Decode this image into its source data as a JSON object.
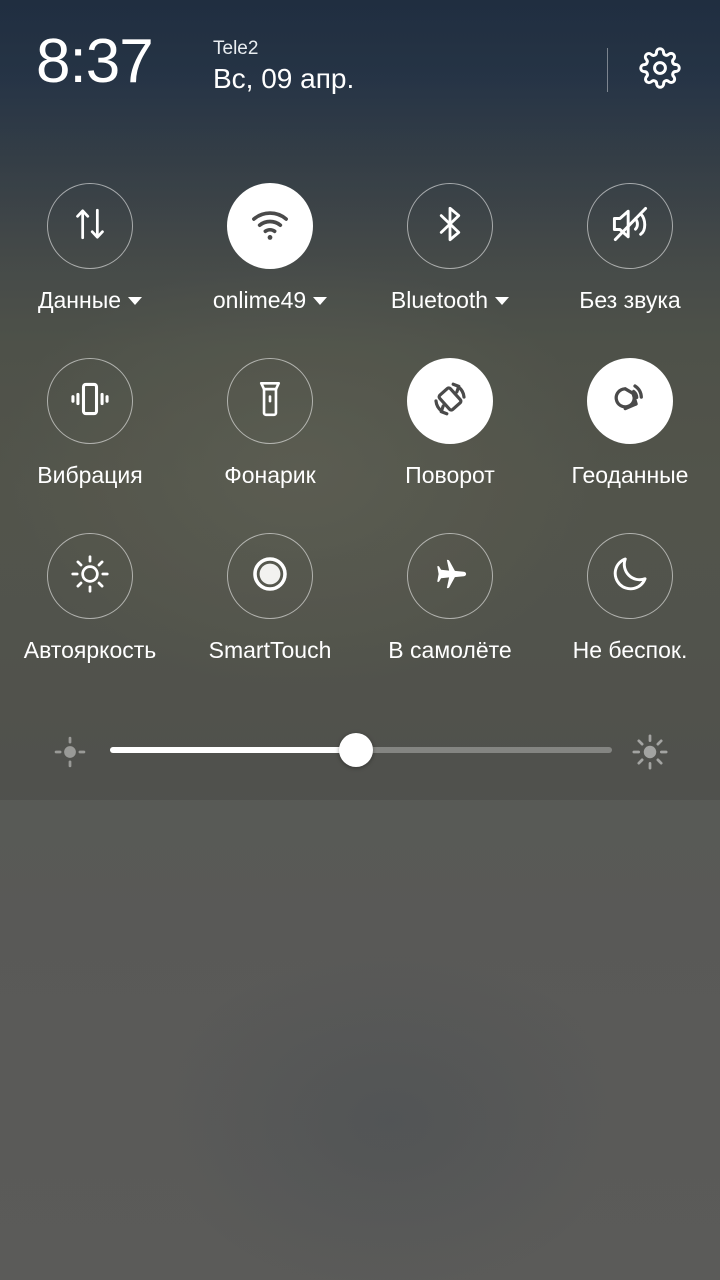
{
  "status_bar": {
    "time": "8:37",
    "carrier": "Tele2",
    "date": "Вс, 09 апр.",
    "settings_icon": "gear-icon"
  },
  "colors": {
    "accent_on_bg": "#ffffff",
    "accent_on_fg": "#4a4a4a",
    "label": "#ffffff",
    "wallpaper_top": "#24374f",
    "wallpaper_bottom": "#5b5b59"
  },
  "tiles": [
    [
      {
        "id": "mobile-data",
        "label": "Данные",
        "icon": "data-transfer-icon",
        "active": false,
        "has_dropdown": true
      },
      {
        "id": "wifi",
        "label": "onlime49",
        "icon": "wifi-icon",
        "active": true,
        "has_dropdown": true
      },
      {
        "id": "bluetooth",
        "label": "Bluetooth",
        "icon": "bluetooth-icon",
        "active": false,
        "has_dropdown": true
      },
      {
        "id": "mute",
        "label": "Без звука",
        "icon": "volume-mute-icon",
        "active": false,
        "has_dropdown": false
      }
    ],
    [
      {
        "id": "vibration",
        "label": "Вибрация",
        "icon": "vibration-icon",
        "active": false,
        "has_dropdown": false
      },
      {
        "id": "flashlight",
        "label": "Фонарик",
        "icon": "flashlight-icon",
        "active": false,
        "has_dropdown": false
      },
      {
        "id": "auto-rotate",
        "label": "Поворот",
        "icon": "screen-rotation-icon",
        "active": true,
        "has_dropdown": false
      },
      {
        "id": "location",
        "label": "Геоданные",
        "icon": "location-icon",
        "active": true,
        "has_dropdown": false
      }
    ],
    [
      {
        "id": "auto-brightness",
        "label": "Автояркость",
        "icon": "brightness-auto-icon",
        "active": false,
        "has_dropdown": false
      },
      {
        "id": "smart-touch",
        "label": "SmartTouch",
        "icon": "smarttouch-icon",
        "active": false,
        "has_dropdown": false
      },
      {
        "id": "airplane-mode",
        "label": "В самолёте",
        "icon": "airplane-icon",
        "active": false,
        "has_dropdown": false
      },
      {
        "id": "do-not-disturb",
        "label": "Не беспок.",
        "icon": "moon-icon",
        "active": false,
        "has_dropdown": false
      }
    ]
  ],
  "brightness_slider": {
    "value_percent": 49,
    "min_icon": "brightness-low-icon",
    "max_icon": "brightness-high-icon"
  }
}
